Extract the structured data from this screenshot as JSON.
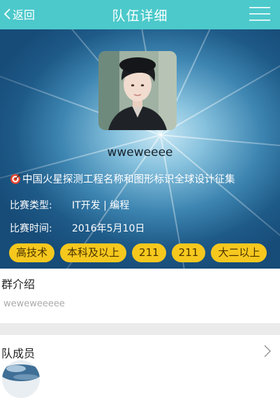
{
  "nav": {
    "back_label": "返回",
    "title": "队伍详细",
    "menu_icon": "menu-icon",
    "bg_color": "#4cc9cb"
  },
  "team": {
    "name": "wweweeee"
  },
  "contest": {
    "name": "中国火星探测工程名称和图形标识全球设计征集",
    "type_label": "比赛类型:",
    "type_value": "IT开发 | 编程",
    "time_label": "比赛时间:",
    "time_value": "2016年5月10日"
  },
  "tags": [
    "高技术",
    "本科及以上",
    "211",
    "211",
    "大二以上"
  ],
  "tag_color": "#f6c81e",
  "intro": {
    "title": "群介绍",
    "text": "weweweeeee"
  },
  "members": {
    "title": "队成员"
  }
}
